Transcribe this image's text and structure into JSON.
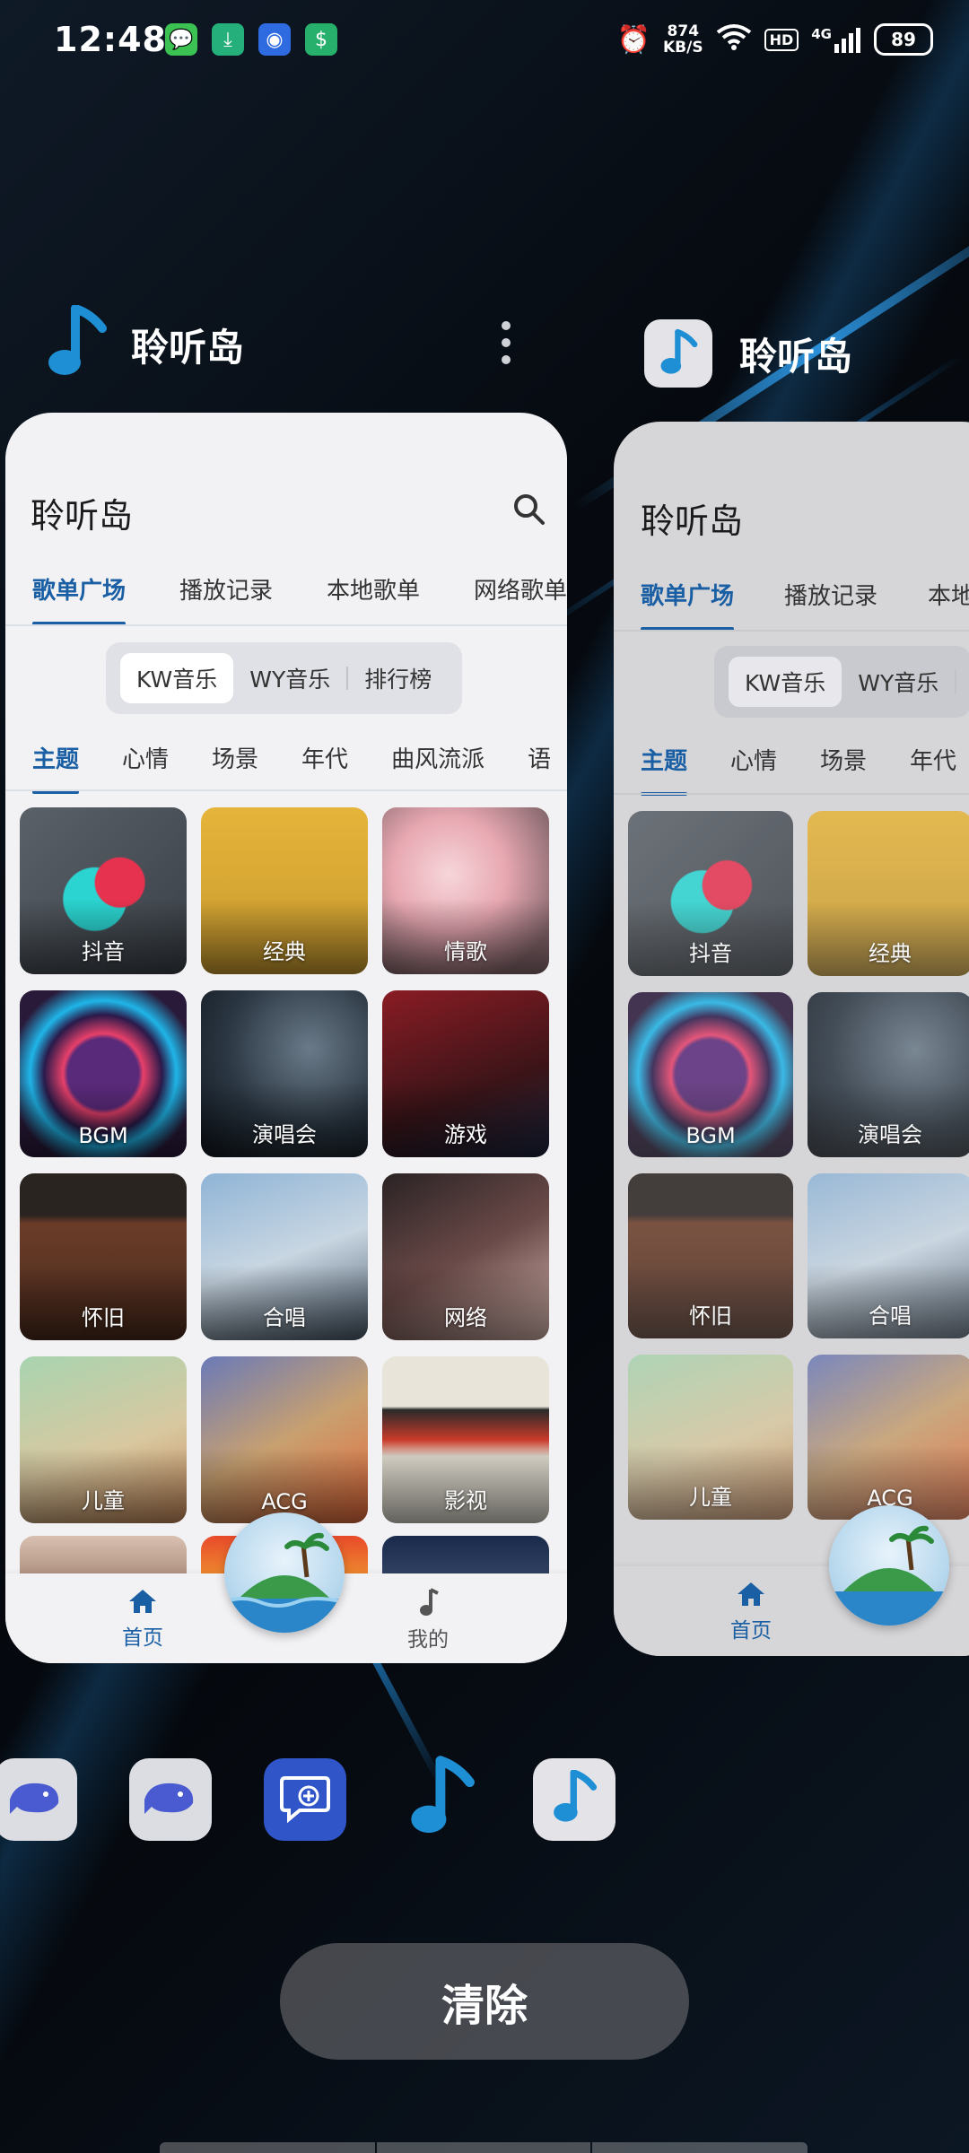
{
  "status_bar": {
    "time": "12:48",
    "net_speed_value": "874",
    "net_speed_unit": "KB/S",
    "hd": "HD",
    "network": "4G",
    "battery": "89"
  },
  "recent_app_main": {
    "app_name": "聆听岛",
    "card": {
      "title": "聆听岛",
      "tabs": [
        "歌单广场",
        "播放记录",
        "本地歌单",
        "网络歌单"
      ],
      "sources": [
        "KW音乐",
        "WY音乐",
        "排行榜"
      ],
      "categories": [
        "主题",
        "心情",
        "场景",
        "年代",
        "曲风流派",
        "语"
      ],
      "playlists": [
        {
          "label": "抖音"
        },
        {
          "label": "经典"
        },
        {
          "label": "情歌"
        },
        {
          "label": "BGM"
        },
        {
          "label": "演唱会"
        },
        {
          "label": "游戏"
        },
        {
          "label": "怀旧"
        },
        {
          "label": "合唱"
        },
        {
          "label": "网络"
        },
        {
          "label": "儿童"
        },
        {
          "label": "ACG"
        },
        {
          "label": "影视"
        }
      ],
      "nav": {
        "home": "首页",
        "mine": "我的"
      }
    }
  },
  "recent_app_second": {
    "app_name": "聆听岛",
    "card": {
      "title": "聆听岛",
      "tabs": [
        "歌单广场",
        "播放记录",
        "本地歌"
      ],
      "sources": [
        "KW音乐",
        "WY音乐"
      ],
      "categories": [
        "主题",
        "心情",
        "场景",
        "年代"
      ],
      "playlists": [
        {
          "label": "抖音"
        },
        {
          "label": "经典"
        },
        {
          "label": "BGM"
        },
        {
          "label": "演唱会"
        },
        {
          "label": "怀旧"
        },
        {
          "label": "合唱"
        },
        {
          "label": "儿童"
        },
        {
          "label": "ACG"
        }
      ],
      "nav": {
        "home": "首页"
      }
    }
  },
  "clear_button": "清除",
  "colors": {
    "accent": "#1a5fa4",
    "music_blue": "#1e8fd4"
  }
}
